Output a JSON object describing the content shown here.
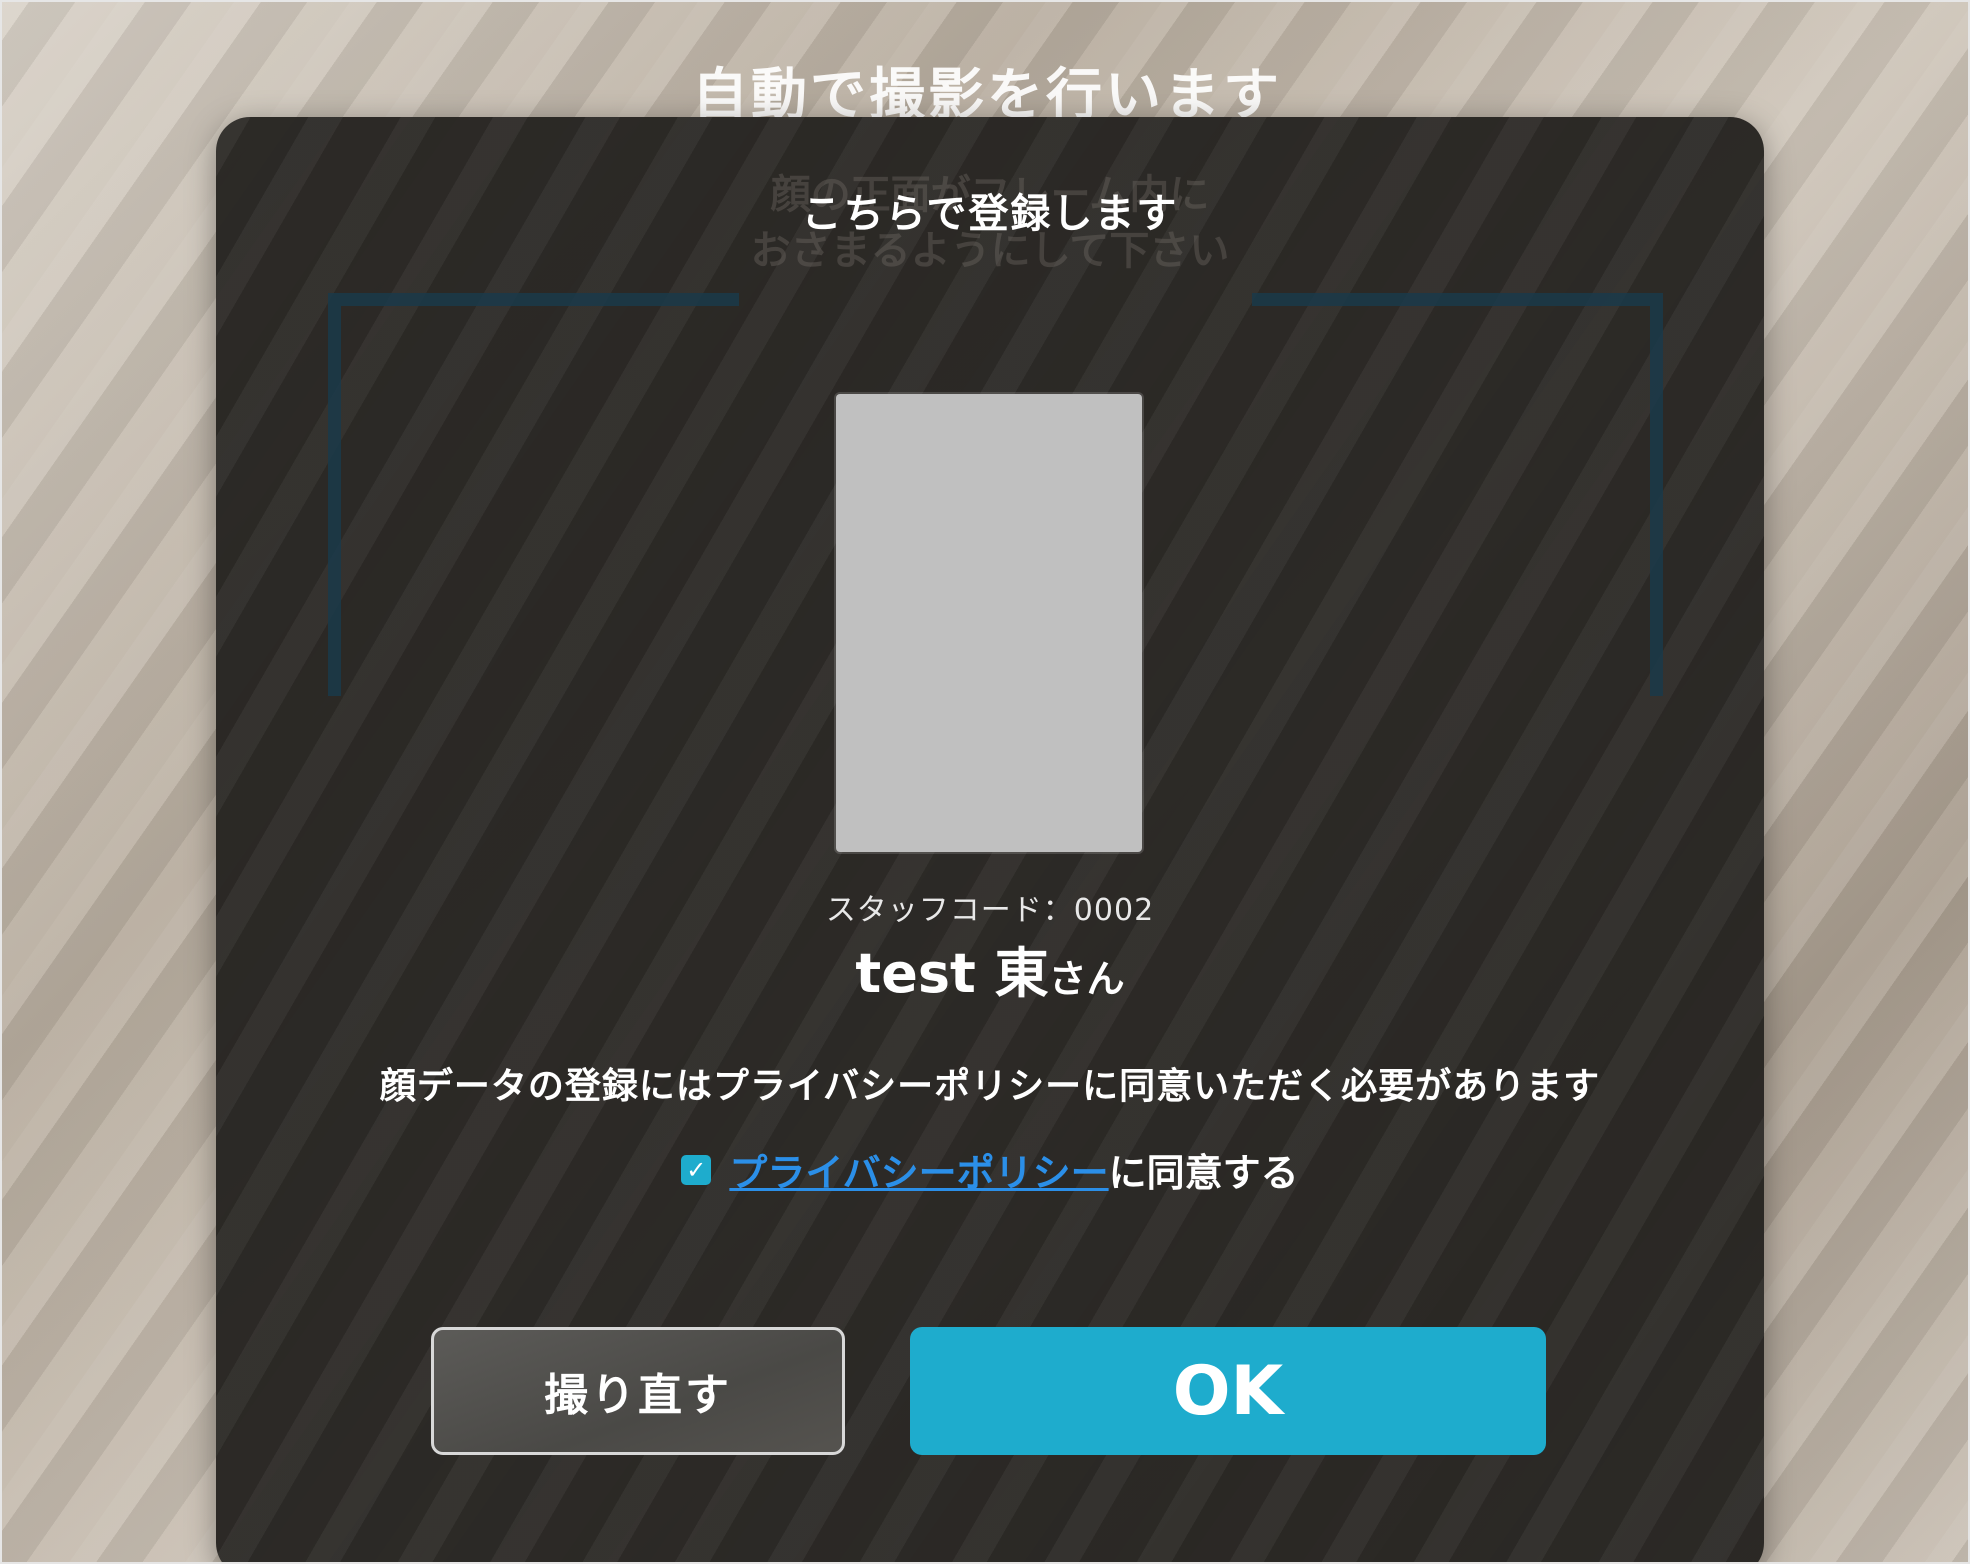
{
  "camera": {
    "title": "自動で撮影を行います"
  },
  "modal": {
    "ghost_guide_line1": "顔の正面がフレーム内に",
    "ghost_guide_line2": "おさまるようにして下さい",
    "title": "こちらで登録します",
    "staff_code_label": "スタッフコード：0002",
    "staff_name": "test 東",
    "staff_name_suffix": "さん",
    "consent_message": "顔データの登録にはプライバシーポリシーに同意いただく必要があります",
    "agree": {
      "checked": true,
      "policy_link_text": "プライバシーポリシー",
      "suffix_text": "に同意する"
    },
    "buttons": {
      "retake_label": "撮り直す",
      "ok_label": "OK"
    }
  },
  "colors": {
    "accent": "#1eaccd",
    "link": "#2b8fe8",
    "modal_bg": "#2a2723"
  },
  "icons": {
    "checkbox": "checkmark-icon"
  }
}
